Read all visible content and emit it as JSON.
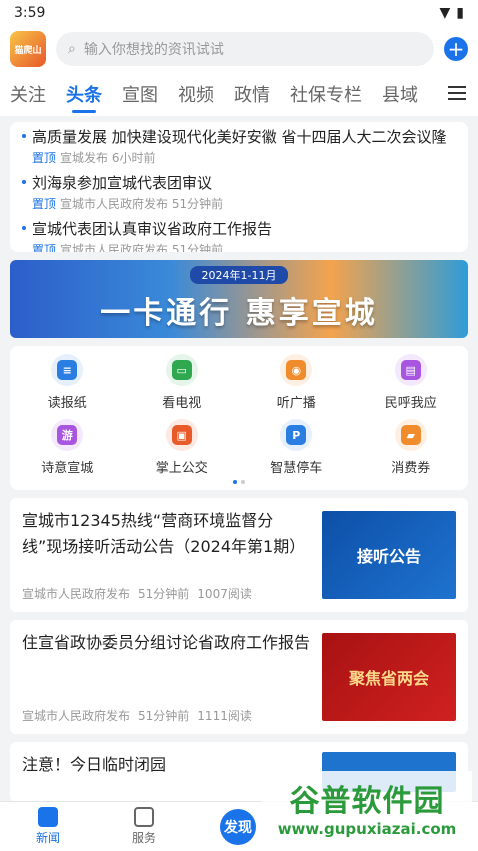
{
  "status": {
    "time": "3:59"
  },
  "search": {
    "placeholder": "输入你想找的资讯试试"
  },
  "logo": {
    "text": "猫爬山"
  },
  "tabs": [
    "关注",
    "头条",
    "宣图",
    "视频",
    "政情",
    "社保专栏",
    "县域"
  ],
  "top_news": [
    {
      "title": "高质量发展 加快建设现代化美好安徽 省十四届人大二次会议隆",
      "pin": "置顶",
      "source": "宣城发布",
      "time": "6小时前"
    },
    {
      "title": "刘海泉参加宣城代表团审议",
      "pin": "置顶",
      "source": "宣城市人民政府发布",
      "time": "51分钟前"
    },
    {
      "title": "宣城代表团认真审议省政府工作报告",
      "pin": "置顶",
      "source": "宣城市人民政府发布",
      "time": "51分钟前"
    }
  ],
  "banner": {
    "date": "2024年1-11月",
    "text": "一卡通行 惠享宣城"
  },
  "services": [
    {
      "label": "读报纸",
      "icon": "newspaper-icon",
      "color": "#2a7de1",
      "bg": "#e6f0fc",
      "glyph": "≡"
    },
    {
      "label": "看电视",
      "icon": "tv-icon",
      "color": "#2fa84f",
      "bg": "#e5f5ea",
      "glyph": "▭"
    },
    {
      "label": "听广播",
      "icon": "radio-icon",
      "color": "#f08c2b",
      "bg": "#fdf0e3",
      "glyph": "◉"
    },
    {
      "label": "民呼我应",
      "icon": "chat-icon",
      "color": "#a855e0",
      "bg": "#f3e8fc",
      "glyph": "▤"
    },
    {
      "label": "诗意宣城",
      "icon": "travel-icon",
      "color": "#a855e0",
      "bg": "#f3e8fc",
      "glyph": "游"
    },
    {
      "label": "掌上公交",
      "icon": "bus-icon",
      "color": "#e85a2a",
      "bg": "#fde8e2",
      "glyph": "▣"
    },
    {
      "label": "智慧停车",
      "icon": "parking-icon",
      "color": "#2a7de1",
      "bg": "#e6f0fc",
      "glyph": "P"
    },
    {
      "label": "消费券",
      "icon": "coupon-icon",
      "color": "#f08c2b",
      "bg": "#fdf0e3",
      "glyph": "▰"
    }
  ],
  "news": [
    {
      "title": "宣城市12345热线“营商环境监督分线”现场接听活动公告（2024年第1期）",
      "source": "宣城市人民政府发布",
      "time": "51分钟前",
      "reads": "1007阅读",
      "thumb": "接听公告"
    },
    {
      "title": "住宣省政协委员分组讨论省政府工作报告",
      "source": "宣城市人民政府发布",
      "time": "51分钟前",
      "reads": "1111阅读",
      "thumb": "聚焦省两会"
    }
  ],
  "partial_news": {
    "title": "注意！今日临时闭园"
  },
  "bottom_nav": {
    "news": "新闻",
    "service": "服务",
    "discover": "发现"
  },
  "watermark": {
    "text": "谷普软件园",
    "url": "www.gupuxiazai.com"
  }
}
